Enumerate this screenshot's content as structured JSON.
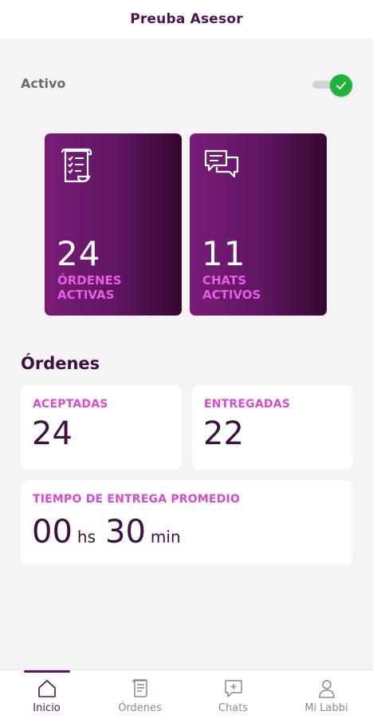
{
  "header": {
    "title": "Preuba Asesor"
  },
  "status": {
    "label": "Activo",
    "toggle_on": true
  },
  "summary_cards": [
    {
      "icon": "scroll-checklist-icon",
      "value": "24",
      "label_line1": "ÓRDENES",
      "label_line2": "ACTIVAS"
    },
    {
      "icon": "chat-bubbles-icon",
      "value": "11",
      "label_line1": "CHATS",
      "label_line2": "ACTIVOS"
    }
  ],
  "orders": {
    "title": "Órdenes",
    "accepted": {
      "label": "ACEPTADAS",
      "value": "24"
    },
    "delivered": {
      "label": "ENTREGADAS",
      "value": "22"
    },
    "avg_time": {
      "label": "TIEMPO DE ENTREGA PROMEDIO",
      "hours": "00",
      "hours_unit": "hs",
      "minutes": "30",
      "minutes_unit": "min"
    }
  },
  "nav": [
    {
      "label": "Inicio",
      "icon": "home-icon",
      "active": true
    },
    {
      "label": "Órdenes",
      "icon": "orders-icon",
      "active": false
    },
    {
      "label": "Chats",
      "icon": "chat-add-icon",
      "active": false
    },
    {
      "label": "Mi Labbi",
      "icon": "user-icon",
      "active": false
    }
  ],
  "colors": {
    "brand": "#4d1450",
    "accent_pink": "#d84ad2",
    "toggle_green": "#1db43a"
  }
}
